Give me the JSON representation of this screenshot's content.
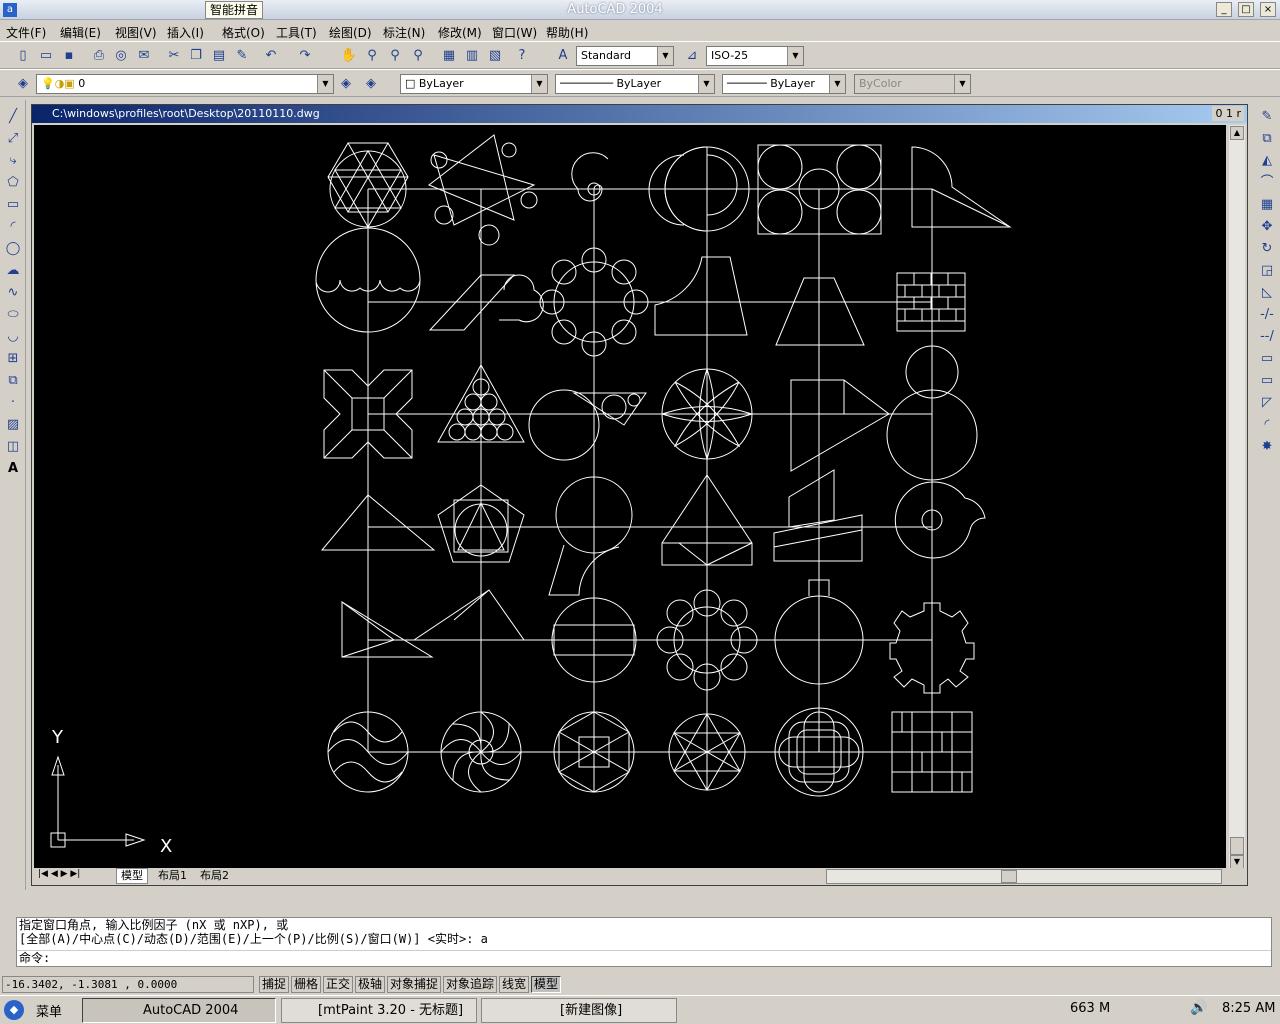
{
  "window": {
    "title": "AutoCAD 2004",
    "ime_label": "智能拼音"
  },
  "menu": [
    "文件(F)",
    "编辑(E)",
    "视图(V)",
    "插入(I)",
    "格式(O)",
    "工具(T)",
    "绘图(D)",
    "标注(N)",
    "修改(M)",
    "窗口(W)",
    "帮助(H)"
  ],
  "toolbar": {
    "text_style": "Standard",
    "dim_style": "ISO-25",
    "layer": "0",
    "color": "ByLayer",
    "linetype": "ByLayer",
    "lineweight": "ByLayer",
    "plotstyle": "ByColor"
  },
  "document": {
    "path": "C:\\windows\\profiles\\root\\Desktop\\20110110.dwg",
    "tabs": [
      "模型",
      "布局1",
      "布局2"
    ],
    "ucs": {
      "x": "X",
      "y": "Y"
    },
    "drawing_rows": [
      [
        "hexagon-star",
        "triangles-circles",
        "spiral",
        "arcs-circle",
        "four-circles-rect",
        "quarter-circle-triangle"
      ],
      [
        "wavy-bowl",
        "parallelogram-hook",
        "scalloped-circle",
        "curved-trapezoid",
        "trapezoid",
        "brick-wall"
      ],
      [
        "cross-x",
        "triangle-circles",
        "circle-tangent-triangle",
        "flower-circle",
        "arrow-pentagon",
        "snowman"
      ],
      [
        "triangle",
        "pentagon-triangle",
        "hook-arc",
        "triangle-quad",
        "stacked-parallelograms",
        "ring-curl"
      ],
      [
        "right-triangles",
        "slanted-triangle",
        "circle-rect",
        "ring-of-circles",
        "circle-neck",
        "gear"
      ],
      [
        "waves-circle",
        "rosette",
        "hexagon-in-circle",
        "star-of-david",
        "knot",
        "parquet"
      ]
    ]
  },
  "command": {
    "line1": "指定窗口角点, 输入比例因子 (nX 或 nXP), 或",
    "line2": "[全部(A)/中心点(C)/动态(D)/范围(E)/上一个(P)/比例(S)/窗口(W)] <实时>: a",
    "prompt": "命令:"
  },
  "status": {
    "coords": "-16.3402,  -1.3081 , 0.0000",
    "buttons": [
      "捕捉",
      "栅格",
      "正交",
      "极轴",
      "对象捕捉",
      "对象追踪",
      "线宽",
      "模型"
    ]
  },
  "taskbar": {
    "menu": "菜单",
    "tasks": [
      "AutoCAD 2004",
      "[mtPaint 3.20 - 无标题]",
      "[新建图像]"
    ],
    "memory": "663 M",
    "clock": "8:25 AM"
  },
  "colors": {
    "canvas": "#000000",
    "lines": "#ffffff",
    "title_start": "#0a246a"
  }
}
